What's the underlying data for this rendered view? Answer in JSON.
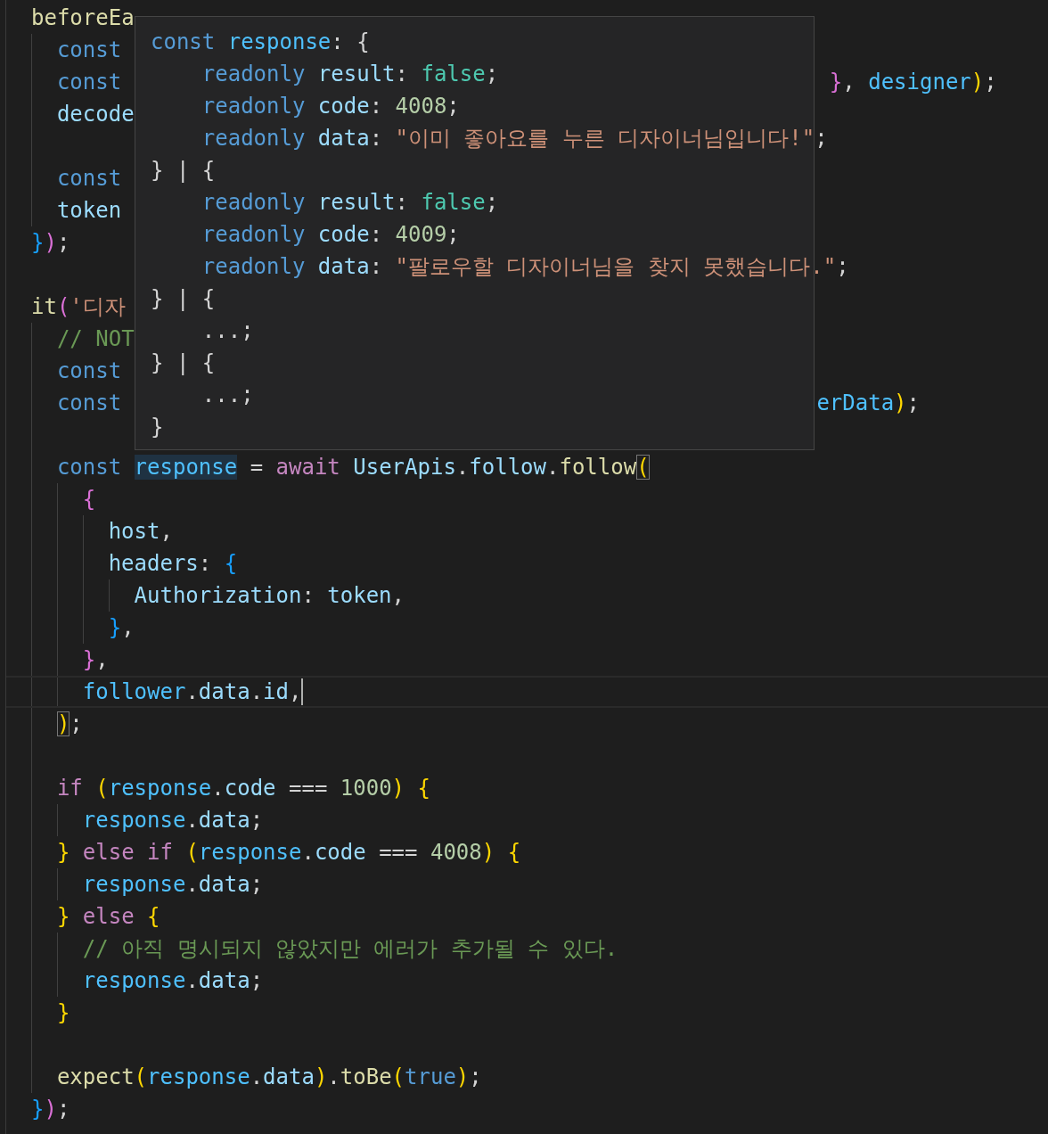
{
  "editor": {
    "lines": [
      {
        "tokens": [
          {
            "text": "beforeEa",
            "kind": "fn"
          }
        ],
        "children": [
          {
            "tokens": [
              {
                "text": "const",
                "kind": "kw"
              }
            ]
          },
          {
            "tokens": [
              {
                "text": "const",
                "kind": "kw"
              }
            ],
            "right": [
              {
                "text": " }",
                "kind": "br2"
              },
              {
                "text": ", ",
                "kind": "punct"
              },
              {
                "text": "designer",
                "kind": "const"
              },
              {
                "text": ")",
                "kind": "br1"
              },
              {
                "text": ";",
                "kind": "punct"
              }
            ]
          },
          {
            "tokens": [
              {
                "text": "decode",
                "kind": "var"
              }
            ]
          },
          {
            "kind": "blank"
          },
          {
            "tokens": [
              {
                "text": "const",
                "kind": "kw"
              }
            ]
          },
          {
            "tokens": [
              {
                "text": "token",
                "kind": "var"
              }
            ]
          }
        ]
      },
      {
        "tokens": [
          {
            "text": "}",
            "kind": "br3"
          },
          {
            "text": ")",
            "kind": "br2"
          },
          {
            "text": ";",
            "kind": "punct"
          }
        ]
      },
      {
        "kind": "blank"
      },
      {
        "tokens": [
          {
            "text": "it",
            "kind": "fn"
          },
          {
            "text": "(",
            "kind": "br2"
          },
          {
            "text": "'디자",
            "kind": "str"
          }
        ],
        "children": [
          {
            "tokens": [
              {
                "text": "// NOT",
                "kind": "cmt"
              }
            ]
          },
          {
            "tokens": [
              {
                "text": "const",
                "kind": "kw"
              }
            ]
          },
          {
            "tokens": [
              {
                "text": "const",
                "kind": "kw"
              }
            ],
            "right": [
              {
                "text": "erData",
                "kind": "const"
              },
              {
                "text": ")",
                "kind": "br1"
              },
              {
                "text": ";",
                "kind": "punct"
              }
            ]
          },
          {
            "kind": "blank"
          },
          {
            "tokens": [
              {
                "text": "const ",
                "kind": "kw"
              },
              {
                "text": "response",
                "kind": "const",
                "highlighted": true
              },
              {
                "text": " = ",
                "kind": "punct"
              },
              {
                "text": "await ",
                "kind": "ctrl"
              },
              {
                "text": "UserApis",
                "kind": "var"
              },
              {
                "text": ".",
                "kind": "punct"
              },
              {
                "text": "follow",
                "kind": "var"
              },
              {
                "text": ".",
                "kind": "punct"
              },
              {
                "text": "follow",
                "kind": "fn"
              },
              {
                "text": "(",
                "kind": "br1",
                "matched": true
              }
            ],
            "children": [
              {
                "tokens": [
                  {
                    "text": "{",
                    "kind": "br2"
                  }
                ],
                "children": [
                  {
                    "tokens": [
                      {
                        "text": "host",
                        "kind": "var"
                      },
                      {
                        "text": ",",
                        "kind": "punct"
                      }
                    ]
                  },
                  {
                    "tokens": [
                      {
                        "text": "headers",
                        "kind": "var"
                      },
                      {
                        "text": ": ",
                        "kind": "punct"
                      },
                      {
                        "text": "{",
                        "kind": "br3"
                      }
                    ],
                    "children": [
                      {
                        "tokens": [
                          {
                            "text": "Authorization",
                            "kind": "var"
                          },
                          {
                            "text": ": ",
                            "kind": "punct"
                          },
                          {
                            "text": "token",
                            "kind": "var"
                          },
                          {
                            "text": ",",
                            "kind": "punct"
                          }
                        ]
                      }
                    ]
                  },
                  {
                    "tokens": [
                      {
                        "text": "}",
                        "kind": "br3"
                      },
                      {
                        "text": ",",
                        "kind": "punct"
                      }
                    ]
                  }
                ]
              },
              {
                "tokens": [
                  {
                    "text": "}",
                    "kind": "br2"
                  },
                  {
                    "text": ",",
                    "kind": "punct"
                  }
                ]
              },
              {
                "current": true,
                "tokens": [
                  {
                    "text": "follower",
                    "kind": "const"
                  },
                  {
                    "text": ".",
                    "kind": "punct"
                  },
                  {
                    "text": "data",
                    "kind": "var"
                  },
                  {
                    "text": ".",
                    "kind": "punct"
                  },
                  {
                    "text": "id",
                    "kind": "var"
                  },
                  {
                    "text": ",",
                    "kind": "punct"
                  }
                ]
              }
            ]
          },
          {
            "tokens": [
              {
                "text": ")",
                "kind": "br1",
                "matched": true
              },
              {
                "text": ";",
                "kind": "punct"
              }
            ]
          },
          {
            "kind": "blank"
          },
          {
            "tokens": [
              {
                "text": "if ",
                "kind": "ctrl"
              },
              {
                "text": "(",
                "kind": "br1"
              },
              {
                "text": "response",
                "kind": "const"
              },
              {
                "text": ".",
                "kind": "punct"
              },
              {
                "text": "code",
                "kind": "var"
              },
              {
                "text": " === ",
                "kind": "punct"
              },
              {
                "text": "1000",
                "kind": "num"
              },
              {
                "text": ") {",
                "kind": "br1"
              }
            ],
            "children": [
              {
                "tokens": [
                  {
                    "text": "response",
                    "kind": "const"
                  },
                  {
                    "text": ".",
                    "kind": "punct"
                  },
                  {
                    "text": "data",
                    "kind": "var"
                  },
                  {
                    "text": ";",
                    "kind": "punct"
                  }
                ]
              }
            ]
          },
          {
            "tokens": [
              {
                "text": "} ",
                "kind": "br1"
              },
              {
                "text": "else if ",
                "kind": "ctrl"
              },
              {
                "text": "(",
                "kind": "br1"
              },
              {
                "text": "response",
                "kind": "const"
              },
              {
                "text": ".",
                "kind": "punct"
              },
              {
                "text": "code",
                "kind": "var"
              },
              {
                "text": " === ",
                "kind": "punct"
              },
              {
                "text": "4008",
                "kind": "num"
              },
              {
                "text": ") {",
                "kind": "br1"
              }
            ],
            "children": [
              {
                "tokens": [
                  {
                    "text": "response",
                    "kind": "const"
                  },
                  {
                    "text": ".",
                    "kind": "punct"
                  },
                  {
                    "text": "data",
                    "kind": "var"
                  },
                  {
                    "text": ";",
                    "kind": "punct"
                  }
                ]
              }
            ]
          },
          {
            "tokens": [
              {
                "text": "} ",
                "kind": "br1"
              },
              {
                "text": "else ",
                "kind": "ctrl"
              },
              {
                "text": "{",
                "kind": "br1"
              }
            ],
            "children": [
              {
                "tokens": [
                  {
                    "text": "// 아직 명시되지 않았지만 에러가 추가될 수 있다.",
                    "kind": "cmt"
                  }
                ]
              },
              {
                "tokens": [
                  {
                    "text": "response",
                    "kind": "const"
                  },
                  {
                    "text": ".",
                    "kind": "punct"
                  },
                  {
                    "text": "data",
                    "kind": "var"
                  },
                  {
                    "text": ";",
                    "kind": "punct"
                  }
                ]
              }
            ]
          },
          {
            "tokens": [
              {
                "text": "}",
                "kind": "br1"
              }
            ]
          },
          {
            "kind": "blank"
          },
          {
            "tokens": [
              {
                "text": "expect",
                "kind": "fn"
              },
              {
                "text": "(",
                "kind": "br1"
              },
              {
                "text": "response",
                "kind": "const"
              },
              {
                "text": ".",
                "kind": "punct"
              },
              {
                "text": "data",
                "kind": "var"
              },
              {
                "text": ")",
                "kind": "br1"
              },
              {
                "text": ".",
                "kind": "punct"
              },
              {
                "text": "toBe",
                "kind": "fn"
              },
              {
                "text": "(",
                "kind": "br1"
              },
              {
                "text": "true",
                "kind": "kw"
              },
              {
                "text": ")",
                "kind": "br1"
              },
              {
                "text": ";",
                "kind": "punct"
              }
            ]
          }
        ]
      },
      {
        "tokens": [
          {
            "text": "}",
            "kind": "br3"
          },
          {
            "text": ")",
            "kind": "br2"
          },
          {
            "text": ";",
            "kind": "punct"
          }
        ]
      }
    ]
  },
  "tooltip": {
    "lines": [
      {
        "tokens": [
          {
            "text": "const ",
            "kind": "kw"
          },
          {
            "text": "response",
            "kind": "const"
          },
          {
            "text": ": {",
            "kind": "punct"
          }
        ],
        "children": [
          {
            "tokens": [
              {
                "text": "readonly ",
                "kind": "kw"
              },
              {
                "text": "result",
                "kind": "var"
              },
              {
                "text": ": ",
                "kind": "punct"
              },
              {
                "text": "false",
                "kind": "bool"
              },
              {
                "text": ";",
                "kind": "punct"
              }
            ]
          },
          {
            "tokens": [
              {
                "text": "readonly ",
                "kind": "kw"
              },
              {
                "text": "code",
                "kind": "var"
              },
              {
                "text": ": ",
                "kind": "punct"
              },
              {
                "text": "4008",
                "kind": "num"
              },
              {
                "text": ";",
                "kind": "punct"
              }
            ]
          },
          {
            "tokens": [
              {
                "text": "readonly ",
                "kind": "kw"
              },
              {
                "text": "data",
                "kind": "var"
              },
              {
                "text": ": ",
                "kind": "punct"
              },
              {
                "text": "\"이미 좋아요를 누른 디자이너님입니다!\"",
                "kind": "str"
              },
              {
                "text": ";",
                "kind": "punct"
              }
            ]
          }
        ]
      },
      {
        "tokens": [
          {
            "text": "} | {",
            "kind": "punct"
          }
        ],
        "children": [
          {
            "tokens": [
              {
                "text": "readonly ",
                "kind": "kw"
              },
              {
                "text": "result",
                "kind": "var"
              },
              {
                "text": ": ",
                "kind": "punct"
              },
              {
                "text": "false",
                "kind": "bool"
              },
              {
                "text": ";",
                "kind": "punct"
              }
            ]
          },
          {
            "tokens": [
              {
                "text": "readonly ",
                "kind": "kw"
              },
              {
                "text": "code",
                "kind": "var"
              },
              {
                "text": ": ",
                "kind": "punct"
              },
              {
                "text": "4009",
                "kind": "num"
              },
              {
                "text": ";",
                "kind": "punct"
              }
            ]
          },
          {
            "tokens": [
              {
                "text": "readonly ",
                "kind": "kw"
              },
              {
                "text": "data",
                "kind": "var"
              },
              {
                "text": ": ",
                "kind": "punct"
              },
              {
                "text": "\"팔로우할 디자이너님을 찾지 못했습니다.\"",
                "kind": "str"
              },
              {
                "text": ";",
                "kind": "punct"
              }
            ]
          }
        ]
      },
      {
        "tokens": [
          {
            "text": "} | {",
            "kind": "punct"
          }
        ],
        "children": [
          {
            "tokens": [
              {
                "text": "...;",
                "kind": "punct"
              }
            ]
          }
        ]
      },
      {
        "tokens": [
          {
            "text": "} | {",
            "kind": "punct"
          }
        ],
        "children": [
          {
            "tokens": [
              {
                "text": "...;",
                "kind": "punct"
              }
            ]
          }
        ]
      },
      {
        "tokens": [
          {
            "text": "}",
            "kind": "punct"
          }
        ]
      }
    ]
  }
}
